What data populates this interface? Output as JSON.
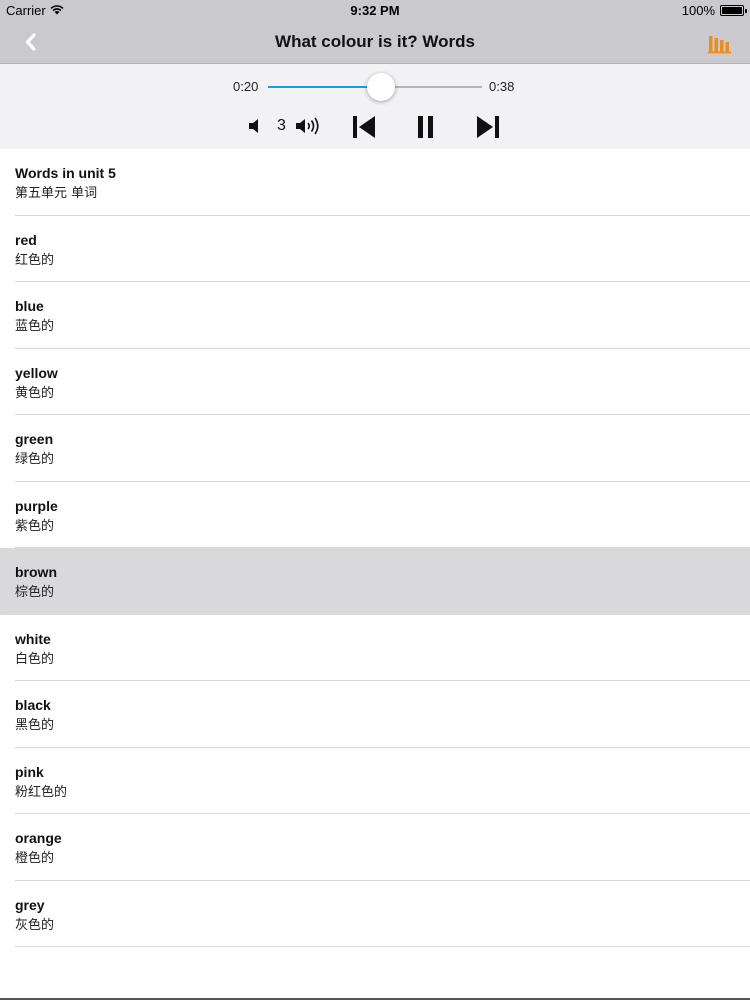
{
  "status_bar": {
    "carrier": "Carrier",
    "time": "9:32 PM",
    "battery": "100%"
  },
  "nav": {
    "title": "What colour is it? Words",
    "accent_color": "#f08c1e",
    "back_icon": "chevron-left-icon",
    "right_icon": "bar-chart-icon"
  },
  "player": {
    "elapsed": "0:20",
    "total": "0:38",
    "progress": 0.526,
    "volume_level": "3",
    "slider_color": "#1d9be4"
  },
  "list": {
    "selected_index": 6,
    "items": [
      {
        "en": "Words in unit 5",
        "zh": "第五单元 单词"
      },
      {
        "en": "red",
        "zh": "红色的"
      },
      {
        "en": "blue",
        "zh": "蓝色的"
      },
      {
        "en": "yellow",
        "zh": "黄色的"
      },
      {
        "en": "green",
        "zh": "绿色的"
      },
      {
        "en": "purple",
        "zh": "紫色的"
      },
      {
        "en": "brown",
        "zh": "棕色的"
      },
      {
        "en": "white",
        "zh": "白色的"
      },
      {
        "en": "black",
        "zh": "黑色的"
      },
      {
        "en": "pink",
        "zh": "粉红色的"
      },
      {
        "en": "orange",
        "zh": "橙色的"
      },
      {
        "en": "grey",
        "zh": "灰色的"
      }
    ]
  }
}
